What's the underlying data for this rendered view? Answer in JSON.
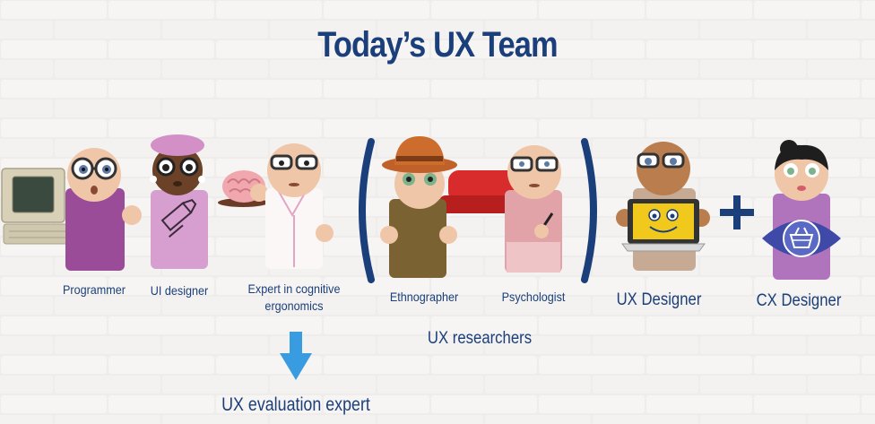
{
  "title": "Today’s UX Team",
  "roles": {
    "programmer": "Programmer",
    "ui_designer": "UI designer",
    "cognitive_line1": "Expert in cognitive",
    "cognitive_line2": "ergonomics",
    "ethnographer": "Ethnographer",
    "psychologist": "Psychologist",
    "ux_designer": "UX Designer",
    "cx_designer": "CX Designer"
  },
  "group_label": "UX researchers",
  "evaluation_label": "UX evaluation expert",
  "plus_sign": "+",
  "colors": {
    "text": "#1b3f7a",
    "arrow": "#3a9ce0",
    "programmer_body": "#9a4c98",
    "ui_designer_body": "#d79ed0",
    "doctor_coat": "#fbf7f6",
    "ethnographer_body": "#7a6232",
    "psychologist_body": "#e2a3a8",
    "sofa": "#d82c2c",
    "ux_designer_body": "#c6aa94",
    "cx_designer_body": "#b074bd",
    "eye_logo": "#3f4aa8"
  },
  "icons": [
    "computer-icon",
    "highlighter-icon",
    "brain-icon",
    "pen-icon",
    "laptop-icon",
    "sofa-icon",
    "eye-basket-icon",
    "down-arrow-icon",
    "plus-icon"
  ]
}
